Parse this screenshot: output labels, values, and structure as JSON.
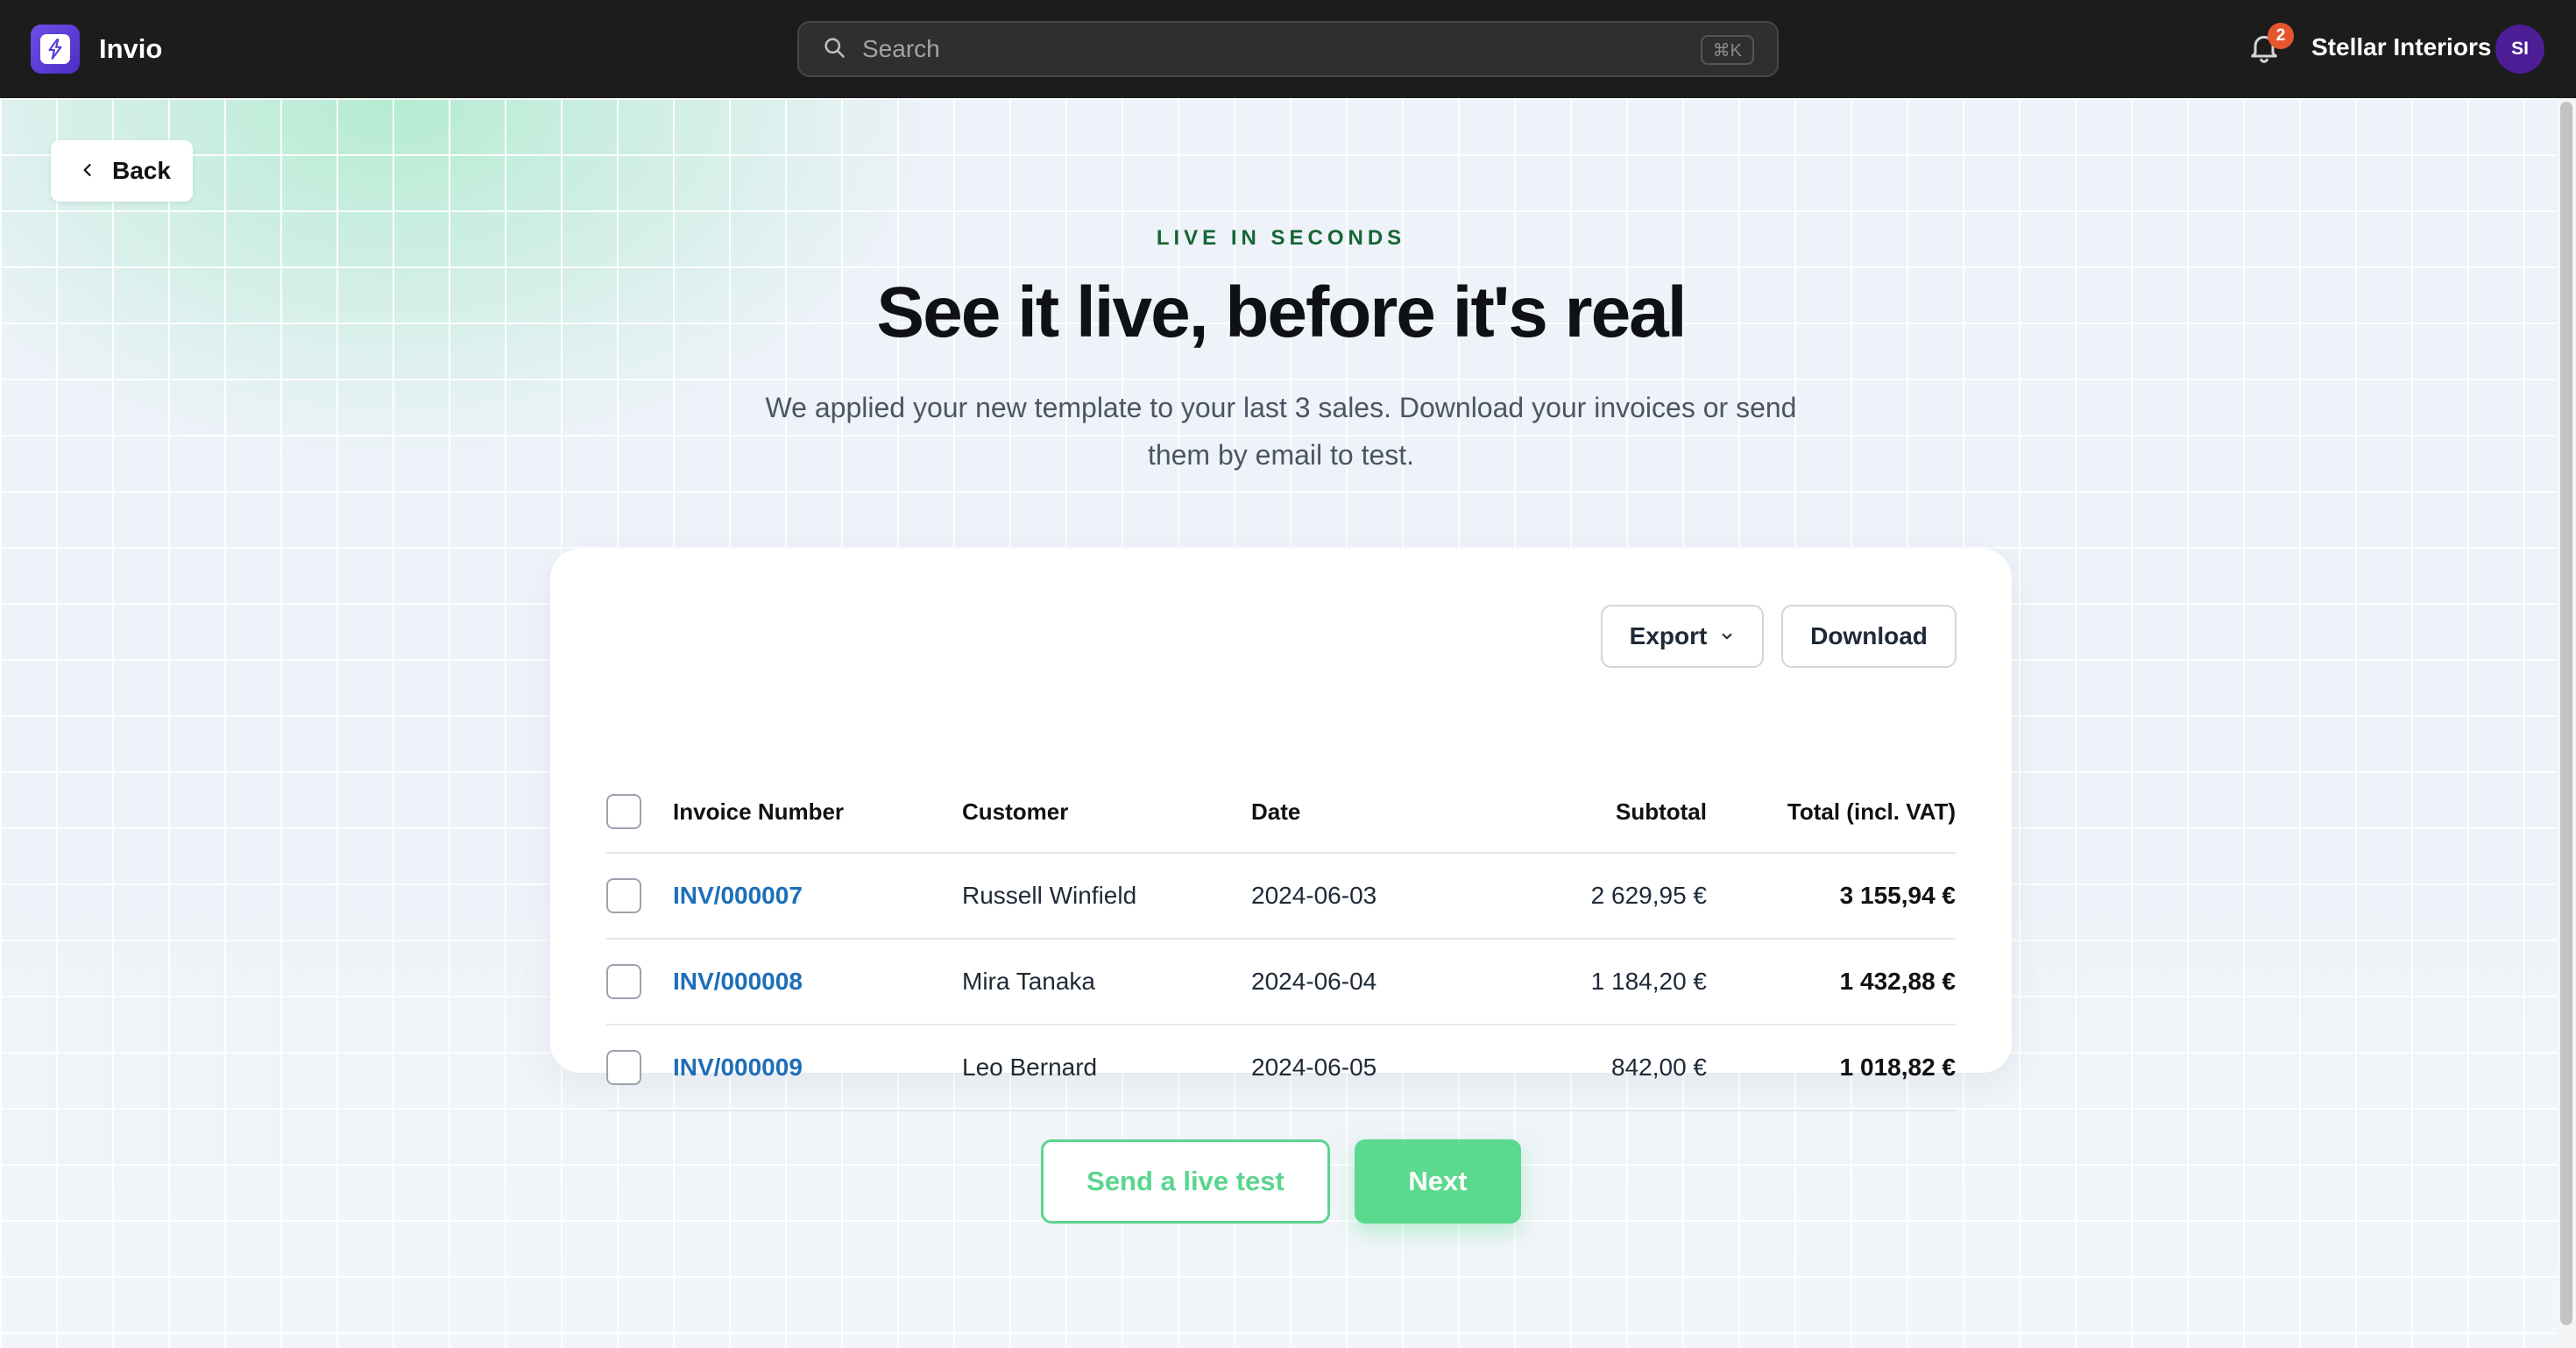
{
  "app": {
    "name": "Invio",
    "logo_icon": "lightning-bolt-icon",
    "accent": "#5b3fd9"
  },
  "search": {
    "placeholder": "Search",
    "shortcut": "⌘K"
  },
  "notifications": {
    "count": "2"
  },
  "account": {
    "company": "Stellar Interiors",
    "initials": "SI"
  },
  "nav": {
    "back_label": "Back"
  },
  "hero": {
    "eyebrow": "LIVE IN SECONDS",
    "title": "See it live, before it's real",
    "subtitle": "We applied your new template to your last 3 sales. Download your invoices or send them by email to test."
  },
  "toolbar": {
    "export_label": "Export",
    "download_label": "Download"
  },
  "table": {
    "columns": [
      "Invoice Number",
      "Customer",
      "Date",
      "Subtotal",
      "Total (incl. VAT)"
    ],
    "rows": [
      {
        "number": "INV/000007",
        "customer": "Russell Winfield",
        "date": "2024-06-03",
        "subtotal": "2 629,95 €",
        "total": "3 155,94 €"
      },
      {
        "number": "INV/000008",
        "customer": "Mira Tanaka",
        "date": "2024-06-04",
        "subtotal": "1 184,20 €",
        "total": "1 432,88 €"
      },
      {
        "number": "INV/000009",
        "customer": "Leo Bernard",
        "date": "2024-06-05",
        "subtotal": "842,00 €",
        "total": "1 018,82 €"
      }
    ]
  },
  "actions": {
    "send_test_label": "Send a live test",
    "next_label": "Next"
  },
  "colors": {
    "primary_green": "#5ad98f",
    "link_blue": "#1d6fb8",
    "eyebrow_green": "#166534",
    "topbar": "#1c1c1c",
    "badge": "#e4572e",
    "avatar": "#4c1d95"
  }
}
